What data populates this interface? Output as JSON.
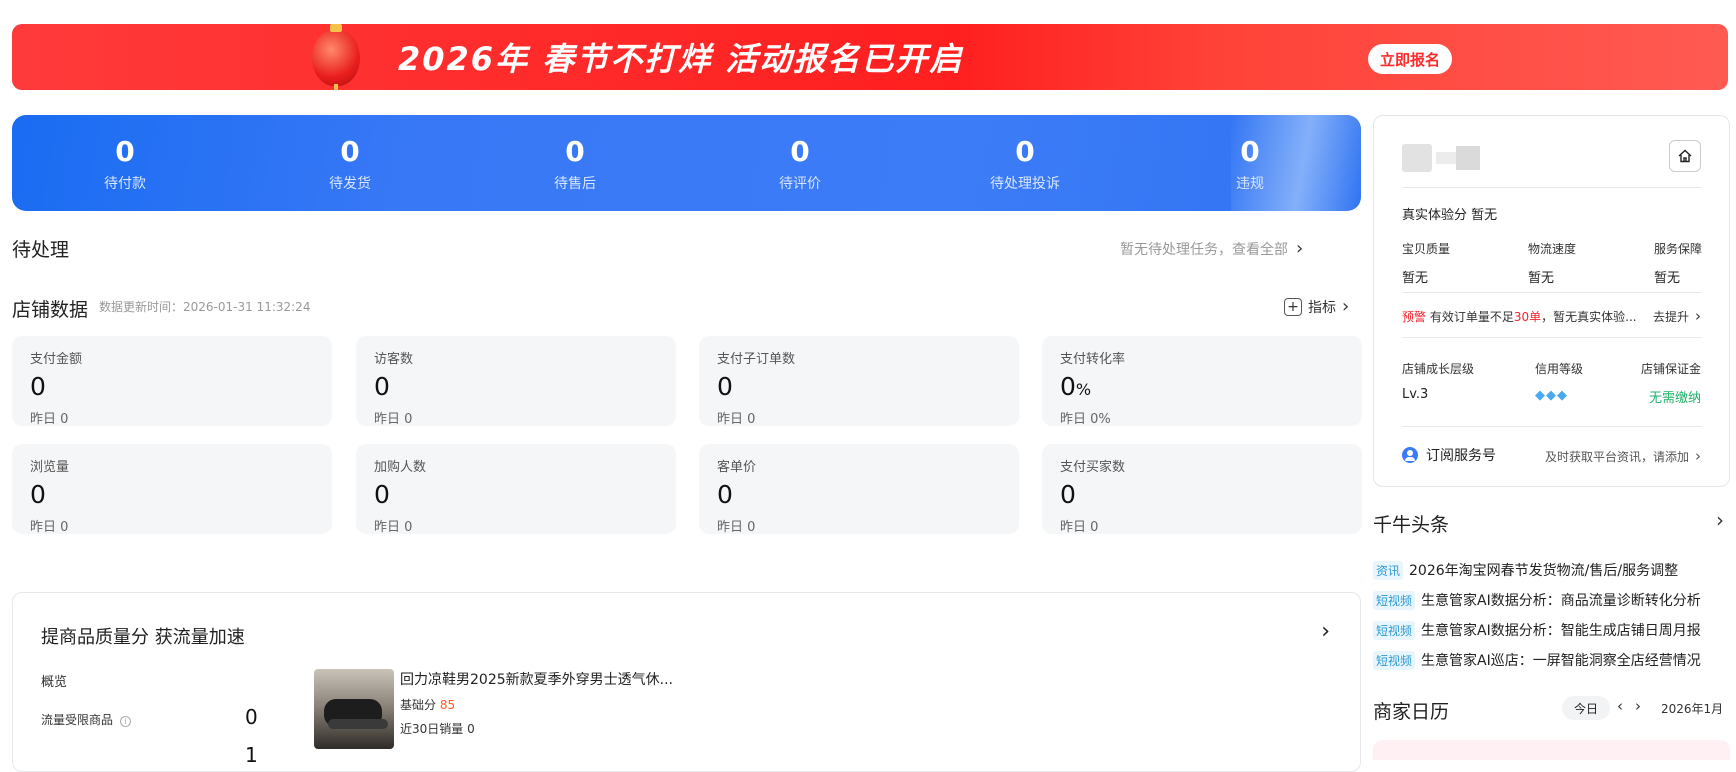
{
  "banner": {
    "title": "2026年 春节不打烊 活动报名已开启",
    "button": "立即报名"
  },
  "status": [
    {
      "value": "0",
      "label": "待付款"
    },
    {
      "value": "0",
      "label": "待发货"
    },
    {
      "value": "0",
      "label": "待售后"
    },
    {
      "value": "0",
      "label": "待评价"
    },
    {
      "value": "0",
      "label": "待处理投诉"
    },
    {
      "value": "0",
      "label": "违规"
    }
  ],
  "pending": {
    "title": "待处理",
    "link": "暂无待处理任务，查看全部"
  },
  "store": {
    "title": "店铺数据",
    "update_time": "数据更新时间：2026-01-31 11:32:24",
    "metrics_link": "指标",
    "cards": [
      {
        "title": "支付金额",
        "value": "0",
        "unit": "",
        "yesterday": "昨日 0"
      },
      {
        "title": "访客数",
        "value": "0",
        "unit": "",
        "yesterday": "昨日 0"
      },
      {
        "title": "支付子订单数",
        "value": "0",
        "unit": "",
        "yesterday": "昨日 0"
      },
      {
        "title": "支付转化率",
        "value": "0",
        "unit": "%",
        "yesterday": "昨日 0%"
      },
      {
        "title": "浏览量",
        "value": "0",
        "unit": "",
        "yesterday": "昨日 0"
      },
      {
        "title": "加购人数",
        "value": "0",
        "unit": "",
        "yesterday": "昨日 0"
      },
      {
        "title": "客单价",
        "value": "0",
        "unit": "",
        "yesterday": "昨日 0"
      },
      {
        "title": "支付买家数",
        "value": "0",
        "unit": "",
        "yesterday": "昨日 0"
      }
    ]
  },
  "quality": {
    "title": "提商品质量分 获流量加速",
    "overview": "概览",
    "restricted_label": "流量受限商品",
    "restricted_value": "0",
    "second_value": "1",
    "product": {
      "name": "回力凉鞋男2025新款夏季外穿男士透气休...",
      "score_label": "基础分",
      "score": "85",
      "sales": "近30日销量 0"
    }
  },
  "profile": {
    "experience": "真实体验分  暂无",
    "scores": [
      {
        "label": "宝贝质量",
        "value": "暂无"
      },
      {
        "label": "物流速度",
        "value": "暂无"
      },
      {
        "label": "服务保障",
        "value": "暂无"
      }
    ],
    "warning_tag": "预警",
    "warning_pre": "有效订单量不足",
    "warning_num": "30单",
    "warning_post": "，暂无真实体验...",
    "improve": "去提升",
    "levels": [
      {
        "label": "店铺成长层级",
        "value": "Lv.3"
      },
      {
        "label": "信用等级",
        "value": ""
      },
      {
        "label": "店铺保证金",
        "value": "无需缴纳"
      }
    ],
    "subscribe": "订阅服务号",
    "subscribe_hint": "及时获取平台资讯，请添加"
  },
  "headlines": {
    "title": "千牛头条",
    "items": [
      {
        "tag": "资讯",
        "text": "2026年淘宝网春节发货物流/售后/服务调整"
      },
      {
        "tag": "短视频",
        "text": "生意管家AI数据分析：商品流量诊断转化分析"
      },
      {
        "tag": "短视频",
        "text": "生意管家AI数据分析：智能生成店铺日周月报"
      },
      {
        "tag": "短视频",
        "text": "生意管家AI巡店：一屏智能洞察全店经营情况"
      }
    ]
  },
  "calendar": {
    "title": "商家日历",
    "today": "今日",
    "month": "2026年1月"
  },
  "colors": {
    "brand_blue": "#3a7af6",
    "banner_red": "#ff2a2a",
    "warn_red": "#f5222d",
    "green": "#20b26b"
  }
}
